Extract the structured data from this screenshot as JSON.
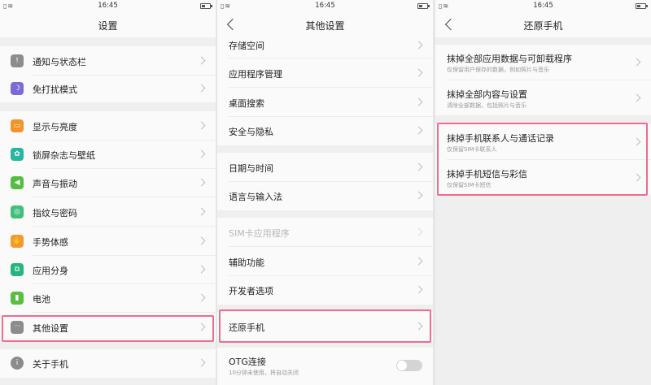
{
  "status_time": "16:45",
  "panel1": {
    "title": "设置",
    "items": [
      {
        "label": "通知与状态栏",
        "icon": "exclamation-icon",
        "color": "#8c8c8c",
        "glyph": "!"
      },
      {
        "label": "免打扰模式",
        "icon": "moon-icon",
        "color": "#7e6ad6",
        "glyph": "☽"
      },
      {
        "label": "显示与亮度",
        "icon": "display-icon",
        "color": "#f3932a",
        "glyph": "▭"
      },
      {
        "label": "锁屏杂志与壁纸",
        "icon": "flower-icon",
        "color": "#26b7a0",
        "glyph": "✿"
      },
      {
        "label": "声音与振动",
        "icon": "speaker-icon",
        "color": "#52bf43",
        "glyph": "◀"
      },
      {
        "label": "指纹与密码",
        "icon": "fingerprint-icon",
        "color": "#3fbf7a",
        "glyph": "◎"
      },
      {
        "label": "手势体感",
        "icon": "hand-icon",
        "color": "#f39a2e",
        "glyph": "✋"
      },
      {
        "label": "应用分身",
        "icon": "clone-icon",
        "color": "#27b47e",
        "glyph": "⧉"
      },
      {
        "label": "电池",
        "icon": "battery-icon",
        "color": "#59bf3f",
        "glyph": "▮"
      },
      {
        "label": "其他设置",
        "icon": "more-icon",
        "color": "#8c8c8c",
        "glyph": "···"
      },
      {
        "label": "关于手机",
        "icon": "info-icon",
        "color": "#8c8c8c",
        "glyph": "i"
      }
    ]
  },
  "panel2": {
    "title": "其他设置",
    "items": [
      {
        "label": "存储空间"
      },
      {
        "label": "应用程序管理"
      },
      {
        "label": "桌面搜索"
      },
      {
        "label": "安全与隐私"
      },
      {
        "label": "日期与时间"
      },
      {
        "label": "语言与输入法"
      },
      {
        "label": "SIM卡应用程序"
      },
      {
        "label": "辅助功能"
      },
      {
        "label": "开发者选项"
      },
      {
        "label": "还原手机"
      },
      {
        "label": "OTG连接",
        "sub": "10分钟未使用，将自动关闭"
      }
    ]
  },
  "panel3": {
    "title": "还原手机",
    "items": [
      {
        "label": "抹掉全部应用数据与可卸载程序",
        "sub": "仅保留用户保存的数据，例如照片与音乐"
      },
      {
        "label": "抹掉全部内容与设置",
        "sub": "清除全部数据，包括照片与音乐"
      },
      {
        "label": "抹掉手机联系人与通话记录",
        "sub": "仅保留SIM卡联系人"
      },
      {
        "label": "抹掉手机短信与彩信",
        "sub": "仅保留SIM卡短信"
      }
    ]
  },
  "colors": {
    "highlight": "#ef6c8e",
    "disabled": "#b8b8b8"
  },
  "otg_toggle_on": false
}
